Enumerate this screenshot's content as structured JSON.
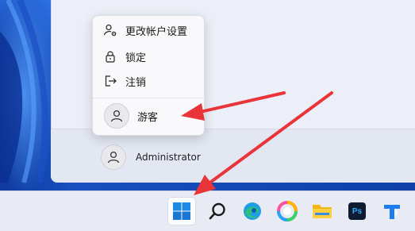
{
  "colors": {
    "accent": "#0a6cd6",
    "arrow": "#e8353a",
    "menu_bg": "#f9f9fb",
    "taskbar_bg": "#e8ebf3"
  },
  "context_menu": {
    "items": [
      {
        "icon": "account-settings-icon",
        "label": "更改帐户设置"
      },
      {
        "icon": "lock-icon",
        "label": "锁定"
      },
      {
        "icon": "sign-out-icon",
        "label": "注销"
      }
    ],
    "guest": {
      "icon": "user-avatar-icon",
      "label": "游客"
    }
  },
  "current_user": {
    "icon": "user-avatar-icon",
    "name": "Administrator"
  },
  "taskbar": {
    "icons": [
      "windows-start-icon",
      "search-icon",
      "edge-icon",
      "photos-icon",
      "file-explorer-icon",
      "photoshop-icon",
      "app-icon"
    ],
    "photoshop_label": "Ps"
  }
}
